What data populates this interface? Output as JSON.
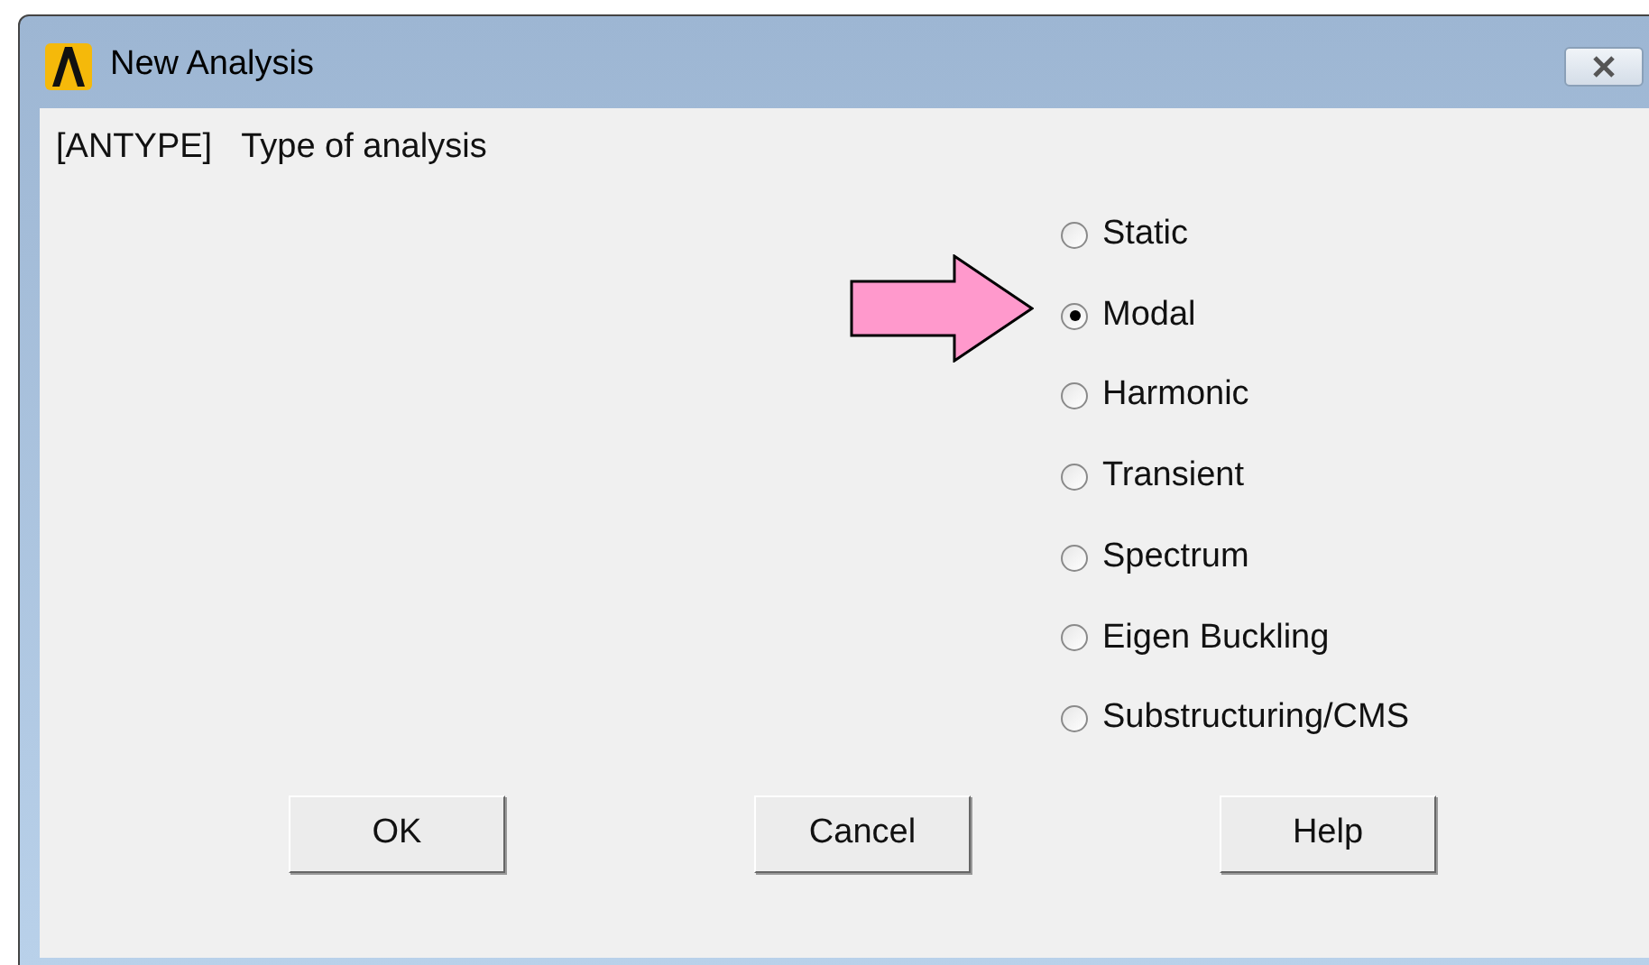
{
  "window": {
    "title": "New Analysis"
  },
  "prompt": {
    "command": "[ANTYPE]",
    "label": "Type of analysis"
  },
  "options": [
    {
      "label": "Static",
      "selected": false
    },
    {
      "label": "Modal",
      "selected": true
    },
    {
      "label": "Harmonic",
      "selected": false
    },
    {
      "label": "Transient",
      "selected": false
    },
    {
      "label": "Spectrum",
      "selected": false
    },
    {
      "label": "Eigen Buckling",
      "selected": false
    },
    {
      "label": "Substructuring/CMS",
      "selected": false
    }
  ],
  "buttons": [
    "OK",
    "Cancel",
    "Help"
  ]
}
